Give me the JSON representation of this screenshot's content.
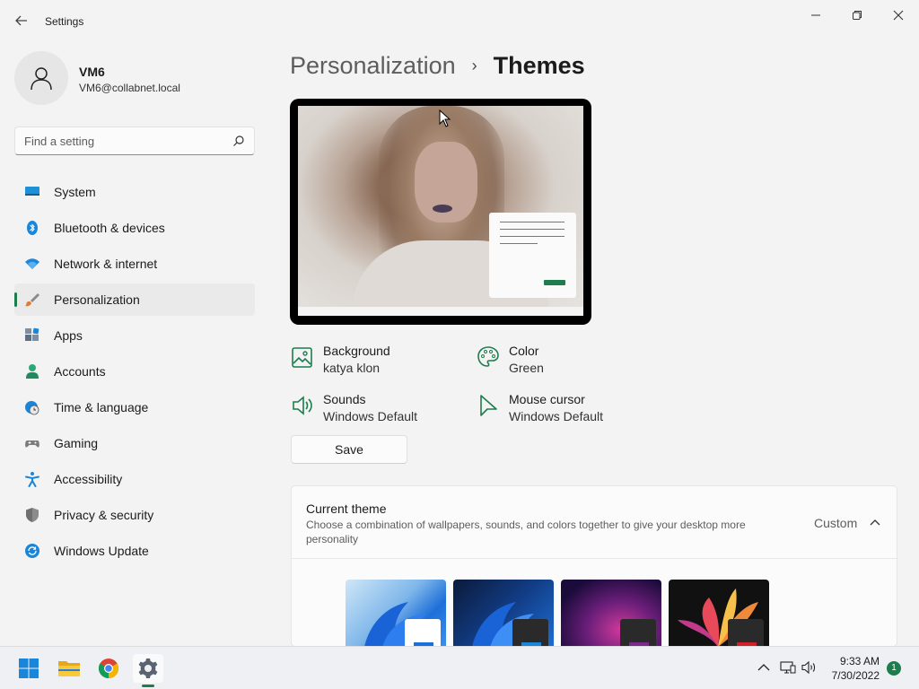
{
  "window": {
    "title": "Settings"
  },
  "profile": {
    "name": "VM6",
    "email": "VM6@collabnet.local"
  },
  "search": {
    "placeholder": "Find a setting"
  },
  "nav": {
    "items": [
      {
        "label": "System",
        "icon": "monitor-icon"
      },
      {
        "label": "Bluetooth & devices",
        "icon": "bluetooth-icon"
      },
      {
        "label": "Network & internet",
        "icon": "wifi-icon"
      },
      {
        "label": "Personalization",
        "icon": "brush-icon",
        "active": true
      },
      {
        "label": "Apps",
        "icon": "apps-icon"
      },
      {
        "label": "Accounts",
        "icon": "person-icon"
      },
      {
        "label": "Time & language",
        "icon": "globe-clock-icon"
      },
      {
        "label": "Gaming",
        "icon": "gamepad-icon"
      },
      {
        "label": "Accessibility",
        "icon": "accessibility-icon"
      },
      {
        "label": "Privacy & security",
        "icon": "shield-icon"
      },
      {
        "label": "Windows Update",
        "icon": "update-icon"
      }
    ]
  },
  "breadcrumb": {
    "parent": "Personalization",
    "current": "Themes"
  },
  "properties": {
    "background": {
      "title": "Background",
      "value": "katya klon"
    },
    "color": {
      "title": "Color",
      "value": "Green"
    },
    "sounds": {
      "title": "Sounds",
      "value": "Windows Default"
    },
    "cursor": {
      "title": "Mouse cursor",
      "value": "Windows Default"
    }
  },
  "save_label": "Save",
  "current_theme": {
    "title": "Current theme",
    "description": "Choose a combination of wallpapers, sounds, and colors together to give your desktop more personality",
    "value": "Custom"
  },
  "tray": {
    "time": "9:33 AM",
    "date": "7/30/2022",
    "notifications": "1"
  },
  "colors": {
    "accent": "#1d7d4c",
    "background": "#f3f3f3"
  }
}
